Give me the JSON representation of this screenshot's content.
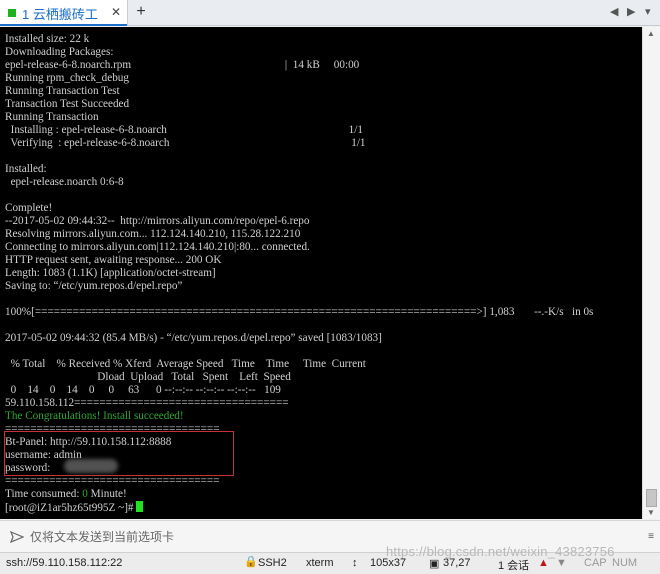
{
  "tabs": [
    {
      "dot_color": "#1fb21f",
      "label": "1 云栖搬砖工",
      "close": "✕"
    }
  ],
  "add_tab": "+",
  "nav": {
    "left": "◀",
    "right": "▶",
    "menu": "▾"
  },
  "terminal": {
    "lines_before_green": [
      "Installed size: 22 k",
      "Downloading Packages:",
      "epel-release-6-8.noarch.rpm                                                       |  14 kB     00:00",
      "Running rpm_check_debug",
      "Running Transaction Test",
      "Transaction Test Succeeded",
      "Running Transaction",
      "  Installing : epel-release-6-8.noarch                                                                 1/1",
      "  Verifying  : epel-release-6-8.noarch                                                                 1/1",
      "",
      "Installed:",
      "  epel-release.noarch 0:6-8",
      "",
      "Complete!",
      "--2017-05-02 09:44:32--  http://mirrors.aliyun.com/repo/epel-6.repo",
      "Resolving mirrors.aliyun.com... 112.124.140.210, 115.28.122.210",
      "Connecting to mirrors.aliyun.com|112.124.140.210|:80... connected.",
      "HTTP request sent, awaiting response... 200 OK",
      "Length: 1083 (1.1K) [application/octet-stream]",
      "Saving to: “/etc/yum.repos.d/epel.repo”",
      "",
      "100%[======================================================================>] 1,083       --.-K/s   in 0s",
      "",
      "2017-05-02 09:44:32 (85.4 MB/s) - “/etc/yum.repos.d/epel.repo” saved [1083/1083]",
      "",
      "  % Total    % Received % Xferd  Average Speed   Time    Time     Time  Current",
      "                                 Dload  Upload   Total   Spent    Left  Speed",
      "  0    14    0    14    0     0     63      0 --:--:-- --:--:-- --:--:--   109",
      "59.110.158.112=================================="
    ],
    "green_line": "The Congratulations! Install succeeded!",
    "lines_after_green": [
      "==================================",
      "Bt-Panel: http://59.110.158.112:8888",
      "username: admin",
      "password: ",
      "=================================="
    ],
    "time_label": "Time consumed: ",
    "time_value": "0",
    "time_unit": " Minute!",
    "prompt": "[root@iZ1ar5hz65t995Z ~]# "
  },
  "scroll": {
    "up": "▲",
    "down": "▼"
  },
  "sendbar": {
    "placeholder": "仅将文本发送到当前选项卡",
    "menu": "≡"
  },
  "status": {
    "address": "ssh://59.110.158.112:22",
    "lock": "🔒",
    "protocol": "SSH2",
    "terminal": "xterm",
    "size_icon": "↕",
    "size": "105x37",
    "pos_icon": "▣",
    "position": "37,27",
    "sessions": "1 会话",
    "up_arrow": "▲",
    "down_arrow": "▼",
    "cap": "CAP",
    "num": "NUM"
  },
  "watermark": "https://blog.csdn.net/weixin_43823756"
}
